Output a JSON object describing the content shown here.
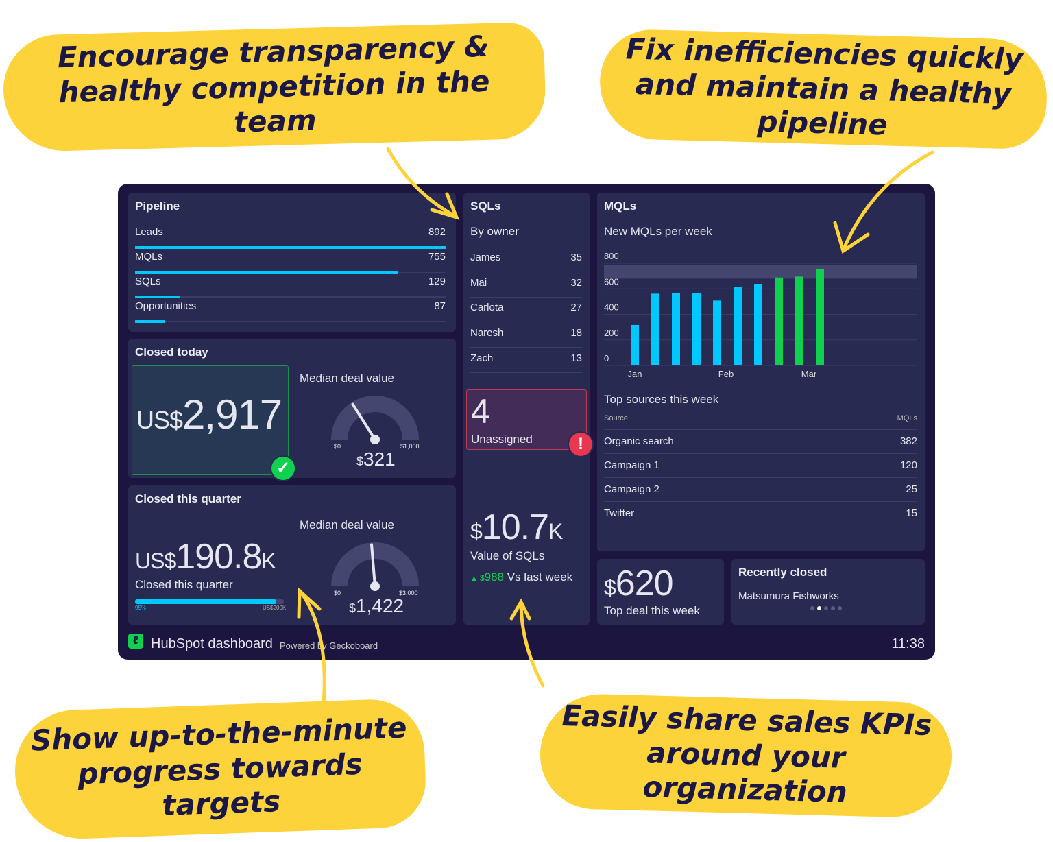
{
  "callouts": {
    "top_left": "Encourage transparency & healthy competition in the team",
    "top_right": "Fix inefficiencies quickly and maintain a healthy pipeline",
    "bottom_left": "Show up-to-the-minute progress towards targets",
    "bottom_right": "Easily share sales KPIs around your organization"
  },
  "colors": {
    "callout": "#fdd33c",
    "dashboard_bg": "#1b1540",
    "panel": "#282a52",
    "accent_blue": "#00c8ff",
    "accent_green": "#10d050",
    "alert_red": "#e8384f"
  },
  "pipeline": {
    "title": "Pipeline",
    "max": 892,
    "items": [
      {
        "label": "Leads",
        "value": 892
      },
      {
        "label": "MQLs",
        "value": 755
      },
      {
        "label": "SQLs",
        "value": 129
      },
      {
        "label": "Opportunities",
        "value": 87
      }
    ]
  },
  "closed_today": {
    "title": "Closed today",
    "currency": "US$",
    "value": "2,917",
    "status_icon": "check-circle-icon",
    "gauge": {
      "label": "Median deal value",
      "min_label": "$0",
      "max_label": "$1,000",
      "min": 0,
      "max": 1000,
      "value": 321,
      "value_prefix": "$",
      "value_text": "321"
    }
  },
  "closed_quarter": {
    "title": "Closed this quarter",
    "currency": "US$",
    "value": "190.8",
    "suffix": "K",
    "subtitle": "Closed this quarter",
    "progress": {
      "percent": 95,
      "percent_label": "95%",
      "target_label": "US$200K"
    },
    "gauge": {
      "label": "Median deal value",
      "min_label": "$0",
      "max_label": "$3,000",
      "min": 0,
      "max": 3000,
      "value": 1422,
      "value_prefix": "$",
      "value_text": "1,422"
    }
  },
  "sqls": {
    "title": "SQLs",
    "subtitle": "By owner",
    "owners": [
      {
        "name": "James",
        "value": 35
      },
      {
        "name": "Mai",
        "value": 32
      },
      {
        "name": "Carlota",
        "value": 27
      },
      {
        "name": "Naresh",
        "value": 18
      },
      {
        "name": "Zach",
        "value": 13
      }
    ],
    "unassigned": {
      "value": "4",
      "label": "Unassigned",
      "icon": "alert-icon"
    },
    "value": {
      "prefix": "$",
      "number": "10.7",
      "suffix": "K",
      "label": "Value of SQLs",
      "change_prefix": "$",
      "change": "988",
      "change_label": "Vs last week",
      "trend_icon": "triangle-up-icon"
    }
  },
  "mqls": {
    "title": "MQLs",
    "chart_data": {
      "type": "bar",
      "title": "New MQLs per week",
      "ylim": [
        0,
        800
      ],
      "yticks": [
        0,
        200,
        400,
        600,
        800
      ],
      "xtick_labels": [
        "Jan",
        "Feb",
        "Mar"
      ],
      "values": [
        317,
        562,
        565,
        569,
        508,
        617,
        639,
        689,
        696,
        753
      ],
      "target_band": [
        680,
        800
      ],
      "bar_colors": [
        "#00c8ff",
        "#00c8ff",
        "#00c8ff",
        "#00c8ff",
        "#00c8ff",
        "#00c8ff",
        "#00c8ff",
        "#10d050",
        "#10d050",
        "#10d050"
      ],
      "grid": true
    },
    "sources": {
      "title": "Top sources this week",
      "col_source": "Source",
      "col_mqls": "MQLs",
      "rows": [
        {
          "source": "Organic search",
          "value": 382
        },
        {
          "source": "Campaign 1",
          "value": 120
        },
        {
          "source": "Campaign 2",
          "value": 25
        },
        {
          "source": "Twitter",
          "value": 15
        }
      ]
    }
  },
  "top_deal": {
    "prefix": "$",
    "value": "620",
    "label": "Top deal this week"
  },
  "recently_closed": {
    "title": "Recently closed",
    "item": "Matsumura Fishworks",
    "pages": 5,
    "active_page": 2
  },
  "footer": {
    "title": "HubSpot dashboard",
    "powered": "Powered by Geckoboard",
    "time": "11:38"
  }
}
